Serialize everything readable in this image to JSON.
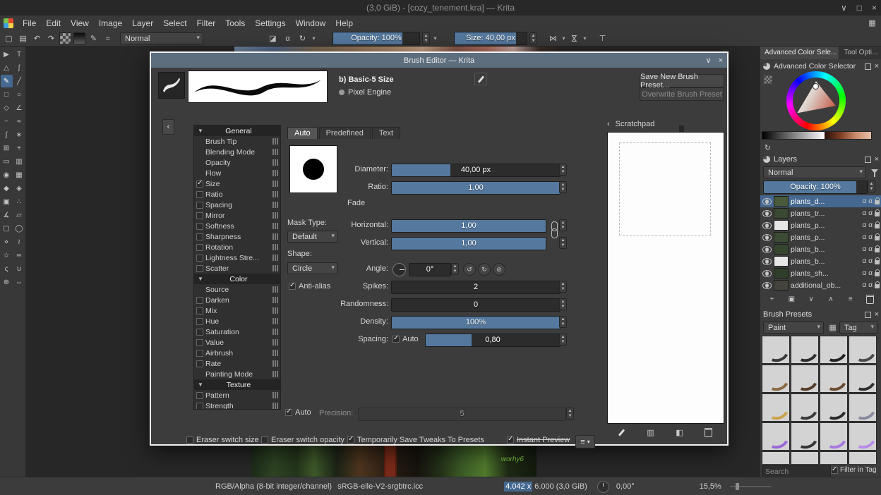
{
  "colors": {
    "accent": "#54789e",
    "selection": "#44688f",
    "dialog_titlebar": "#5d6e7f"
  },
  "window": {
    "title": "(3,0 GiB) - [cozy_tenement.kra] — Krita",
    "controls": [
      "minimize",
      "maximize",
      "close"
    ]
  },
  "menubar": {
    "items": [
      "File",
      "Edit",
      "View",
      "Image",
      "Layer",
      "Select",
      "Filter",
      "Tools",
      "Settings",
      "Window",
      "Help"
    ]
  },
  "toolbar": {
    "blending_mode": "Normal",
    "opacity": "Opacity: 100%",
    "size": "Size: 40,00 px",
    "icons": [
      {
        "name": "new-document-icon",
        "glyph": "▢"
      },
      {
        "name": "save-document-icon",
        "glyph": "▤"
      },
      {
        "name": "undo-icon",
        "glyph": "↶"
      },
      {
        "name": "redo-icon",
        "glyph": "↷"
      },
      {
        "name": "pattern-chooser-icon",
        "glyph": ""
      },
      {
        "name": "gradient-chooser-icon",
        "glyph": ""
      },
      {
        "name": "brush-settings-toggle-icon",
        "glyph": "✎"
      },
      {
        "name": "brush-preset-chooser-icon",
        "glyph": "≈"
      }
    ],
    "mode_icons": [
      {
        "name": "eraser-mode-icon",
        "glyph": "◪"
      },
      {
        "name": "preserve-alpha-icon",
        "glyph": "α"
      },
      {
        "name": "reload-preset-icon",
        "glyph": "↻"
      }
    ],
    "mirror_icons": [
      {
        "name": "mirror-horizontal-icon",
        "glyph": "⋈"
      },
      {
        "name": "mirror-vertical-icon",
        "glyph": "⋈"
      }
    ],
    "wrap_icon": {
      "name": "wrap-around-icon",
      "glyph": "⊤"
    },
    "workspace_icon": {
      "name": "workspace-chooser-icon",
      "glyph": "▦"
    }
  },
  "toolbox": {
    "tools": [
      {
        "name": "select-shapes-tool",
        "glyph": "▶"
      },
      {
        "name": "text-tool",
        "glyph": "T"
      },
      {
        "name": "edit-shapes-tool",
        "glyph": "△"
      },
      {
        "name": "calligraphy-tool",
        "glyph": "ʃ"
      },
      {
        "name": "freehand-brush-tool",
        "glyph": "✎",
        "active": true
      },
      {
        "name": "line-tool",
        "glyph": "╱"
      },
      {
        "name": "rectangle-tool",
        "glyph": "□"
      },
      {
        "name": "ellipse-tool",
        "glyph": "○"
      },
      {
        "name": "polygon-tool",
        "glyph": "◇"
      },
      {
        "name": "polyline-tool",
        "glyph": "∠"
      },
      {
        "name": "bezier-curve-tool",
        "glyph": "~"
      },
      {
        "name": "freehand-path-tool",
        "glyph": "≈"
      },
      {
        "name": "dynamic-brush-tool",
        "glyph": "∫"
      },
      {
        "name": "multibrush-tool",
        "glyph": "∗"
      },
      {
        "name": "transform-tool",
        "glyph": "⊞"
      },
      {
        "name": "move-tool",
        "glyph": "+"
      },
      {
        "name": "crop-tool",
        "glyph": "▭"
      },
      {
        "name": "gradient-tool",
        "glyph": "▥"
      },
      {
        "name": "color-sampler-tool",
        "glyph": "◉"
      },
      {
        "name": "pattern-edit-tool",
        "glyph": "▦"
      },
      {
        "name": "fill-tool",
        "glyph": "◆"
      },
      {
        "name": "enclose-fill-tool",
        "glyph": "◈"
      },
      {
        "name": "smart-patch-tool",
        "glyph": "▣"
      },
      {
        "name": "assistants-tool",
        "glyph": "∴"
      },
      {
        "name": "measure-tool",
        "glyph": "∡"
      },
      {
        "name": "reference-images-tool",
        "glyph": "▱"
      },
      {
        "name": "rect-select-tool",
        "glyph": "▢"
      },
      {
        "name": "ellipse-select-tool",
        "glyph": "◯"
      },
      {
        "name": "polygon-select-tool",
        "glyph": "⋄"
      },
      {
        "name": "freehand-select-tool",
        "glyph": "≀"
      },
      {
        "name": "contiguous-select-tool",
        "glyph": "☆"
      },
      {
        "name": "similar-select-tool",
        "glyph": "≃"
      },
      {
        "name": "bezier-select-tool",
        "glyph": "ς"
      },
      {
        "name": "magnetic-select-tool",
        "glyph": "∪"
      },
      {
        "name": "zoom-tool",
        "glyph": "⊕"
      },
      {
        "name": "pan-tool",
        "glyph": "⇔"
      }
    ]
  },
  "canvas": {
    "signature": "worhy6"
  },
  "dialog": {
    "title": "Brush Editor — Krita",
    "preset_name": "b) Basic-5 Size",
    "engine": "Pixel Engine",
    "save_new_button": "Save New Brush Preset...",
    "overwrite_button": "Overwrite Brush Preset",
    "tabs": [
      "Auto",
      "Predefined",
      "Text"
    ],
    "active_tab": "Auto",
    "options": [
      {
        "label": "General",
        "type": "section"
      },
      {
        "label": "Brush Tip",
        "type": "plain"
      },
      {
        "label": "Blending Mode",
        "type": "plain"
      },
      {
        "label": "Opacity",
        "type": "plain"
      },
      {
        "label": "Flow",
        "type": "plain"
      },
      {
        "label": "Size",
        "type": "check",
        "checked": true
      },
      {
        "label": "Ratio",
        "type": "check",
        "checked": false
      },
      {
        "label": "Spacing",
        "type": "check",
        "checked": false
      },
      {
        "label": "Mirror",
        "type": "check",
        "checked": false
      },
      {
        "label": "Softness",
        "type": "check",
        "checked": false
      },
      {
        "label": "Sharpness",
        "type": "check",
        "checked": false
      },
      {
        "label": "Rotation",
        "type": "check",
        "checked": false
      },
      {
        "label": "Lightness Stre...",
        "type": "check",
        "checked": false
      },
      {
        "label": "Scatter",
        "type": "check",
        "checked": false
      },
      {
        "label": "Color",
        "type": "section"
      },
      {
        "label": "Source",
        "type": "plain"
      },
      {
        "label": "Darken",
        "type": "check",
        "checked": false
      },
      {
        "label": "Mix",
        "type": "check",
        "checked": false
      },
      {
        "label": "Hue",
        "type": "check",
        "checked": false
      },
      {
        "label": "Saturation",
        "type": "check",
        "checked": false
      },
      {
        "label": "Value",
        "type": "check",
        "checked": false
      },
      {
        "label": "Airbrush",
        "type": "check",
        "checked": false
      },
      {
        "label": "Rate",
        "type": "check",
        "checked": false
      },
      {
        "label": "Painting Mode",
        "type": "plain"
      },
      {
        "label": "Texture",
        "type": "section"
      },
      {
        "label": "Pattern",
        "type": "check",
        "checked": false
      },
      {
        "label": "Strength",
        "type": "check",
        "checked": false
      }
    ],
    "mask_type_label": "Mask Type:",
    "mask_type": "Default",
    "shape_label": "Shape:",
    "shape": "Circle",
    "anti_alias_label": "Anti-alias",
    "fade_label": "Fade",
    "rows": {
      "diameter": {
        "label": "Diameter:",
        "value": "40,00 px"
      },
      "ratio": {
        "label": "Ratio:",
        "value": "1,00"
      },
      "horizontal": {
        "label": "Horizontal:",
        "value": "1,00"
      },
      "vertical": {
        "label": "Vertical:",
        "value": "1,00"
      },
      "angle": {
        "label": "Angle:",
        "value": "0°"
      },
      "spikes": {
        "label": "Spikes:",
        "value": "2"
      },
      "randomness": {
        "label": "Randomness:",
        "value": "0"
      },
      "density": {
        "label": "Density:",
        "value": "100%"
      },
      "spacing": {
        "label": "Spacing:",
        "auto_label": "Auto",
        "value": "0,80"
      }
    },
    "footer": {
      "auto_label": "Auto",
      "precision_label": "Precision:",
      "precision_value": "5",
      "eraser_switch_size": "Eraser switch size",
      "eraser_switch_opacity": "Eraser switch opacity",
      "save_tweaks": "Temporarily Save Tweaks To Presets",
      "instant_preview": "Instant Preview"
    },
    "scratchpad": {
      "title": "Scratchpad"
    }
  },
  "right": {
    "tabs": [
      "Advanced Color Sele...",
      "Tool Opti..."
    ],
    "color_selector": {
      "title": "Advanced Color Selector"
    },
    "layers": {
      "title": "Layers",
      "blending_mode": "Normal",
      "opacity": "Opacity: 100%",
      "rows": [
        {
          "name": "plants_d...",
          "selected": true,
          "thumb": "#49593a"
        },
        {
          "name": "plants_tr...",
          "selected": false,
          "thumb": "#3a4a32"
        },
        {
          "name": "plants_p...",
          "selected": false,
          "thumb": "#e6e6e6"
        },
        {
          "name": "plants_p...",
          "selected": false,
          "thumb": "#3c4c34"
        },
        {
          "name": "plants_b...",
          "selected": false,
          "thumb": "#35452e"
        },
        {
          "name": "plants_b...",
          "selected": false,
          "thumb": "#e6e6e6"
        },
        {
          "name": "plants_sh...",
          "selected": false,
          "thumb": "#2e3e28"
        },
        {
          "name": "additional_ob...",
          "selected": false,
          "thumb": "#44443c"
        }
      ],
      "buttons": [
        {
          "name": "add-layer-button",
          "glyph": "+"
        },
        {
          "name": "duplicate-layer-button",
          "glyph": "▣"
        },
        {
          "name": "move-layer-down-button",
          "glyph": "∨"
        },
        {
          "name": "move-layer-up-button",
          "glyph": "∧"
        },
        {
          "name": "layer-properties-button",
          "glyph": "≡"
        },
        {
          "name": "delete-layer-button",
          "glyph": ""
        }
      ]
    },
    "presets": {
      "title": "Brush Presets",
      "tag_filter": "Paint",
      "tag_button": "Tag",
      "search_placeholder": "Search",
      "filter_in_tag": "Filter in Tag",
      "items": [
        {
          "ink": "#3a3a3a"
        },
        {
          "ink": "#2e2e2e"
        },
        {
          "ink": "#242424"
        },
        {
          "ink": "#4a4a4a"
        },
        {
          "ink": "#8a6a42"
        },
        {
          "ink": "#553d28"
        },
        {
          "ink": "#6b4a2e"
        },
        {
          "ink": "#2f2f2f"
        },
        {
          "ink": "#caa24a"
        },
        {
          "ink": "#3a3a3a"
        },
        {
          "ink": "#2b2b2b"
        },
        {
          "ink": "#8a8aa0"
        },
        {
          "ink": "#9a68d8"
        },
        {
          "ink": "#343434"
        },
        {
          "ink": "#a678e0"
        },
        {
          "ink": "#b98ae8"
        },
        {
          "ink": "#7a4fc8"
        },
        {
          "ink": "#2d2d2d"
        },
        {
          "ink": "#9a68d8"
        },
        {
          "ink": "#262626"
        }
      ]
    }
  },
  "statusbar": {
    "color_model": "RGB/Alpha (8-bit integer/channel)",
    "icc_profile": "sRGB-elle-V2-srgbtrc.icc",
    "doc_size_selected": "4.042 x",
    "doc_size_rest": "6.000 (3,0 GiB)",
    "rotation": "0,00°",
    "zoom": "15,5%"
  }
}
